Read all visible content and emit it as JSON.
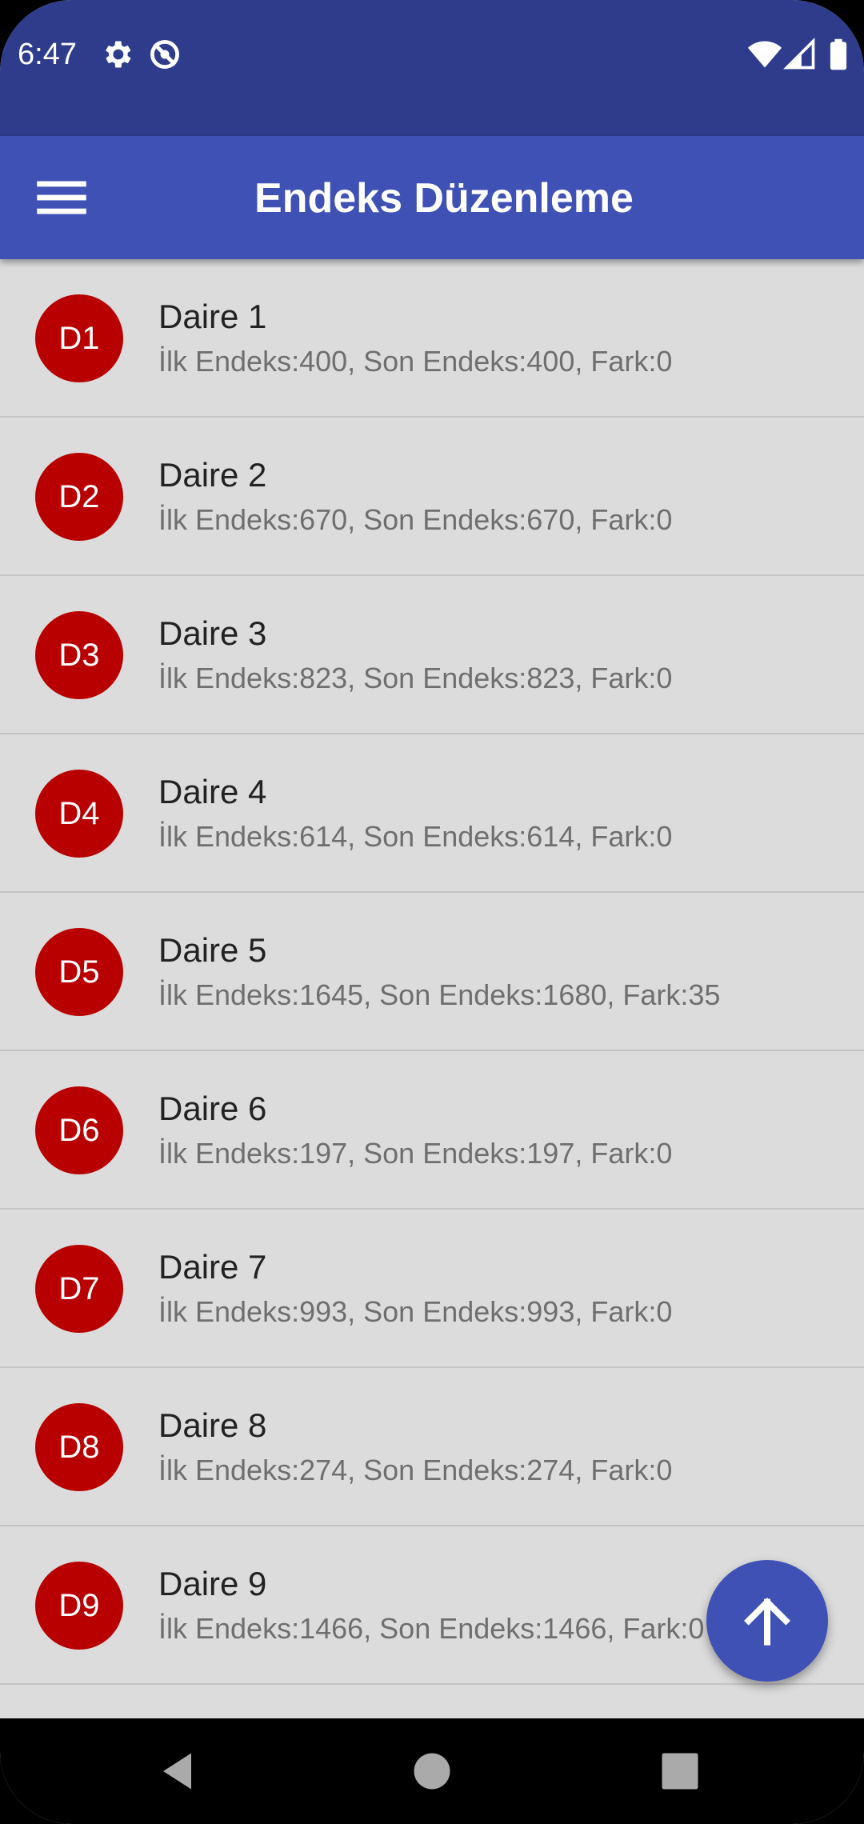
{
  "status_bar": {
    "time": "6:47",
    "icons": [
      "settings-icon",
      "no-sync-icon",
      "wifi-icon",
      "signal-icon",
      "battery-icon"
    ]
  },
  "app_bar": {
    "title": "Endeks Düzenleme",
    "menu_icon": "hamburger-menu-icon"
  },
  "list": {
    "items": [
      {
        "badge": "D1",
        "title": "Daire 1",
        "subtitle": "İlk Endeks:400, Son Endeks:400, Fark:0"
      },
      {
        "badge": "D2",
        "title": "Daire 2",
        "subtitle": "İlk Endeks:670, Son Endeks:670, Fark:0"
      },
      {
        "badge": "D3",
        "title": "Daire 3",
        "subtitle": "İlk Endeks:823, Son Endeks:823, Fark:0"
      },
      {
        "badge": "D4",
        "title": "Daire 4",
        "subtitle": "İlk Endeks:614, Son Endeks:614, Fark:0"
      },
      {
        "badge": "D5",
        "title": "Daire 5",
        "subtitle": "İlk Endeks:1645, Son Endeks:1680, Fark:35"
      },
      {
        "badge": "D6",
        "title": "Daire 6",
        "subtitle": "İlk Endeks:197, Son Endeks:197, Fark:0"
      },
      {
        "badge": "D7",
        "title": "Daire 7",
        "subtitle": "İlk Endeks:993, Son Endeks:993, Fark:0"
      },
      {
        "badge": "D8",
        "title": "Daire 8",
        "subtitle": "İlk Endeks:274, Son Endeks:274, Fark:0"
      },
      {
        "badge": "D9",
        "title": "Daire 9",
        "subtitle": "İlk Endeks:1466, Son Endeks:1466, Fark:0"
      }
    ]
  },
  "fab": {
    "icon": "arrow-up-icon"
  },
  "colors": {
    "status_bar": "#2e3c8b",
    "app_bar": "#3f51b5",
    "badge": "#b80000",
    "list_background": "#dcdcdc"
  },
  "nav_bar": {
    "icons": [
      "back-icon",
      "home-icon",
      "recents-icon"
    ]
  }
}
